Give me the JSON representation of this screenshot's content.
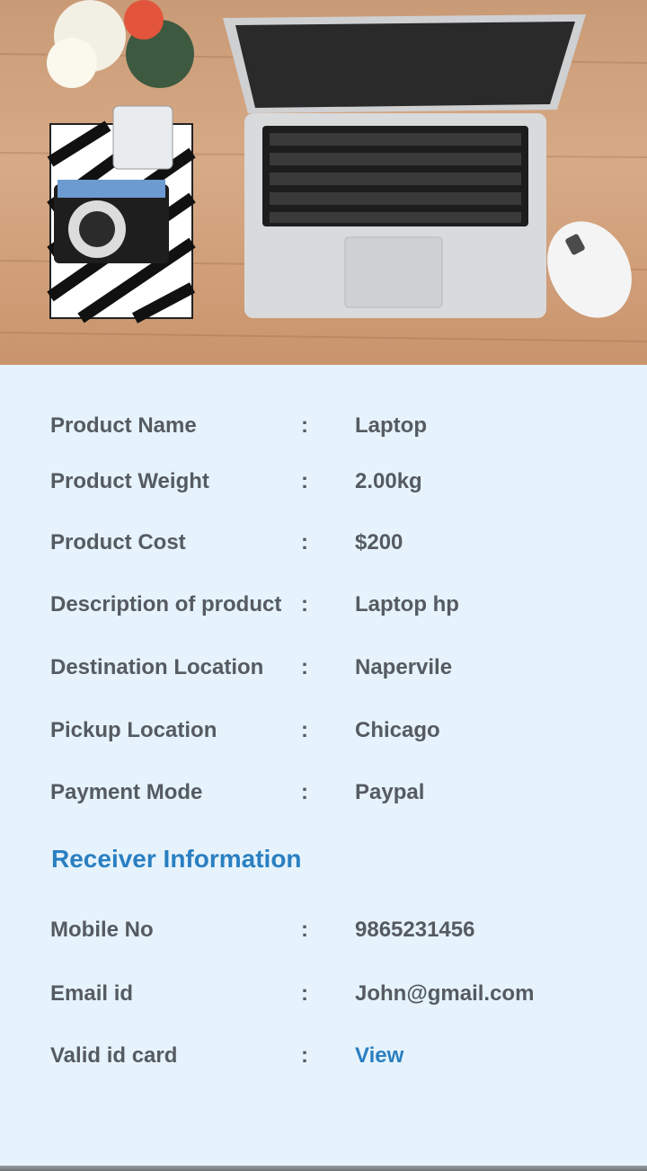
{
  "product": {
    "rows": [
      {
        "label": "Product Name",
        "colon": ":",
        "value": "Laptop"
      },
      {
        "label": "Product Weight",
        "colon": ":",
        "value": "2.00kg"
      },
      {
        "label": "Product Cost",
        "colon": ":",
        "value": "$200"
      },
      {
        "label": "Description of product",
        "colon": ":",
        "value": "Laptop hp"
      },
      {
        "label": "Destination Location",
        "colon": ":",
        "value": "Napervile"
      },
      {
        "label": "Pickup Location",
        "colon": ":",
        "value": "Chicago"
      },
      {
        "label": "Payment Mode",
        "colon": ":",
        "value": "Paypal"
      }
    ]
  },
  "receiver": {
    "title": "Receiver Information",
    "rows": [
      {
        "label": "Mobile No",
        "colon": ":",
        "value": "9865231456"
      },
      {
        "label": "Email id",
        "colon": ":",
        "value": "John@gmail.com"
      },
      {
        "label": "Valid id card",
        "colon": ":",
        "value": "View"
      }
    ]
  },
  "colors": {
    "background": "#e6f3fc",
    "text": "#555b61",
    "accent": "#2a7fc1"
  },
  "hero": {
    "icons": [
      "laptop-icon",
      "camera-icon",
      "mouse-icon",
      "flower-vase-icon",
      "notebook-icon"
    ]
  }
}
